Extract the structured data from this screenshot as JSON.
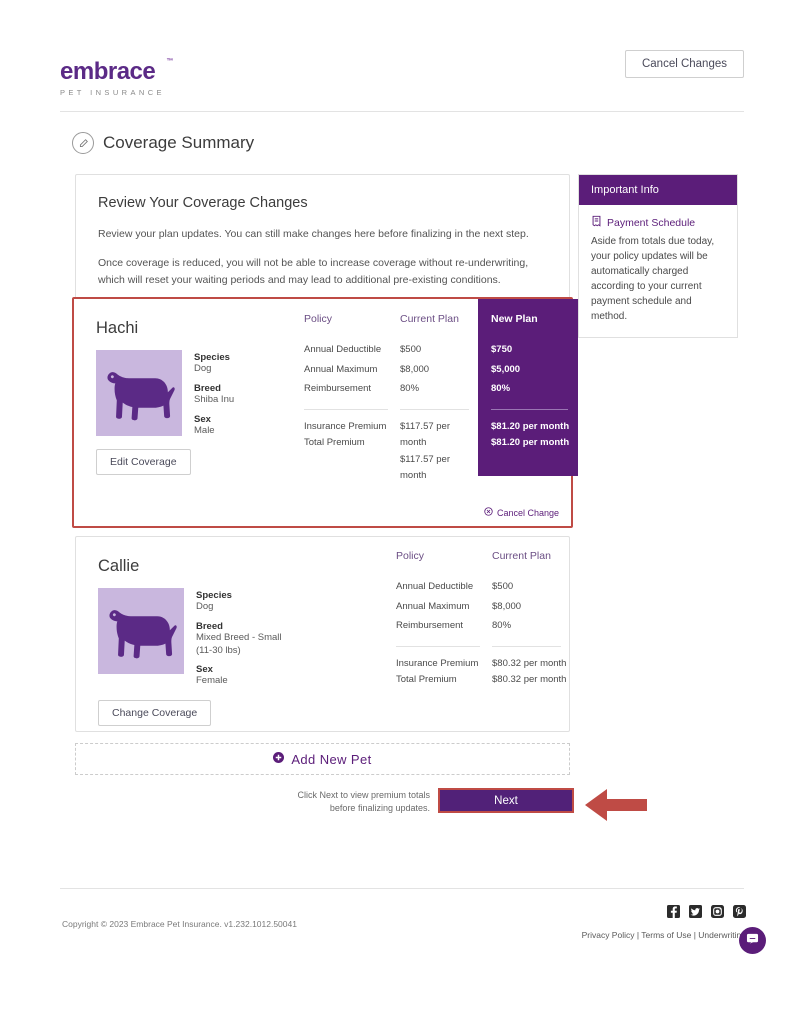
{
  "header": {
    "logo_word": "embrace",
    "logo_tm": "™",
    "logo_sub": "PET INSURANCE",
    "cancel_changes_label": "Cancel Changes"
  },
  "page": {
    "title": "Coverage Summary",
    "title_icon": "edit-pencil-icon"
  },
  "review": {
    "heading": "Review Your Coverage Changes",
    "paragraph_1": "Review your plan updates. You can still make changes here before finalizing in the next step.",
    "paragraph_2": "Once coverage is reduced, you will not be able to increase coverage without re-underwriting, which will reset your waiting periods and may lead to additional pre-existing conditions."
  },
  "sidebar": {
    "heading": "Important Info",
    "section_icon": "receipt-icon",
    "section_title": "Payment Schedule",
    "body": "Aside from totals due today, your policy updates will be automatically charged according to your current payment schedule and method."
  },
  "pets": [
    {
      "name": "Hachi",
      "photo_icon": "dog-silhouette-icon",
      "species_label": "Species",
      "species_value": "Dog",
      "breed_label": "Breed",
      "breed_value": "Shiba Inu",
      "sex_label": "Sex",
      "sex_value": "Male",
      "button_label": "Edit Coverage",
      "has_new_plan": true,
      "highlighted": true,
      "cancel_change_label": "Cancel Change",
      "table": {
        "col_policy_header": "Policy",
        "col_current_header": "Current Plan",
        "col_new_header": "New Plan",
        "rows": [
          {
            "label": "Annual Deductible",
            "current": "$500",
            "new": "$750"
          },
          {
            "label": "Annual Maximum",
            "current": "$8,000",
            "new": "$5,000"
          },
          {
            "label": "Reimbursement",
            "current": "80%",
            "new": "80%"
          }
        ],
        "totals": [
          {
            "label": "Insurance Premium",
            "current": "$117.57 per month",
            "new": "$81.20 per month"
          },
          {
            "label": "Total Premium",
            "current": "$117.57 per month",
            "new": "$81.20 per month"
          }
        ]
      }
    },
    {
      "name": "Callie",
      "photo_icon": "dog-silhouette-icon",
      "species_label": "Species",
      "species_value": "Dog",
      "breed_label": "Breed",
      "breed_value": "Mixed Breed - Small (11-30 lbs)",
      "sex_label": "Sex",
      "sex_value": "Female",
      "button_label": "Change Coverage",
      "has_new_plan": false,
      "highlighted": false,
      "table": {
        "col_policy_header": "Policy",
        "col_current_header": "Current Plan",
        "rows": [
          {
            "label": "Annual Deductible",
            "current": "$500"
          },
          {
            "label": "Annual Maximum",
            "current": "$8,000"
          },
          {
            "label": "Reimbursement",
            "current": "80%"
          }
        ],
        "totals": [
          {
            "label": "Insurance Premium",
            "current": "$80.32 per month"
          },
          {
            "label": "Total Premium",
            "current": "$80.32 per month"
          }
        ]
      }
    }
  ],
  "add_pet": {
    "icon": "plus-circle-icon",
    "label": "Add New Pet"
  },
  "next_section": {
    "hint": "Click Next to view premium totals before finalizing updates.",
    "button_label": "Next",
    "annotation_icon": "red-left-arrow-icon"
  },
  "footer": {
    "copyright": "Copyright © 2023  Embrace Pet Insurance. v1.232.1012.50041",
    "social": [
      {
        "name": "facebook-icon"
      },
      {
        "name": "twitter-icon"
      },
      {
        "name": "instagram-icon"
      },
      {
        "name": "pinterest-icon"
      }
    ],
    "links": [
      {
        "label": "Privacy Policy"
      },
      {
        "label": "Terms of Use"
      },
      {
        "label": "Underwriting"
      }
    ],
    "link_separator": " | ",
    "chat_icon": "chat-bubble-icon"
  },
  "colors": {
    "brand_purple": "#5b1d79",
    "deep_purple": "#512178",
    "highlight_red": "#bf4b45",
    "pet_photo_bg": "#c9b7de",
    "logo_purple": "#7b3fa0"
  }
}
